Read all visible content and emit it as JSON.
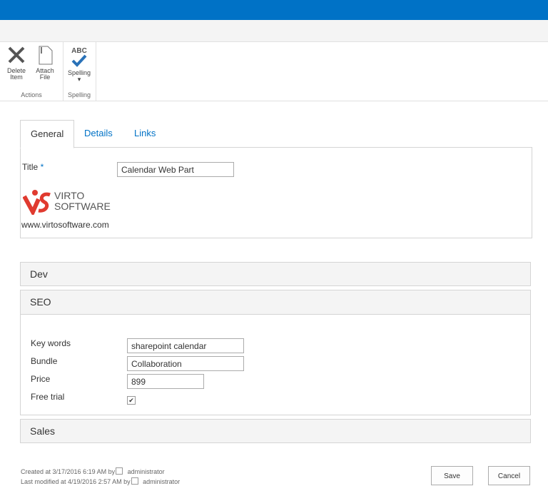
{
  "ribbon": {
    "actions": {
      "label": "Actions",
      "delete": [
        "Delete",
        "Item"
      ],
      "attach": [
        "Attach",
        "File"
      ]
    },
    "spelling": {
      "label": "Spelling",
      "button": "Spelling",
      "abc": "ABC"
    }
  },
  "tabs": [
    "General",
    "Details",
    "Links"
  ],
  "general": {
    "title_label": "Title",
    "required": "*",
    "title_value": "Calendar Web Part",
    "logo": [
      "VIRTO",
      "SOFTWARE"
    ],
    "url": "www.virtosoftware.com"
  },
  "sections": {
    "dev": "Dev",
    "seo": "SEO",
    "sales": "Sales"
  },
  "seo": {
    "keywords_label": "Key words",
    "keywords": "sharepoint calendar",
    "bundle_label": "Bundle",
    "bundle": "Collaboration",
    "price_label": "Price",
    "price": "899",
    "trial_label": "Free trial",
    "trial": true
  },
  "footer": {
    "created": "Created at 3/17/2016 6:19 AM by",
    "modified": "Last modified at 4/19/2016 2:57 AM by",
    "user": "administrator"
  },
  "buttons": {
    "save": "Save",
    "cancel": "Cancel"
  }
}
